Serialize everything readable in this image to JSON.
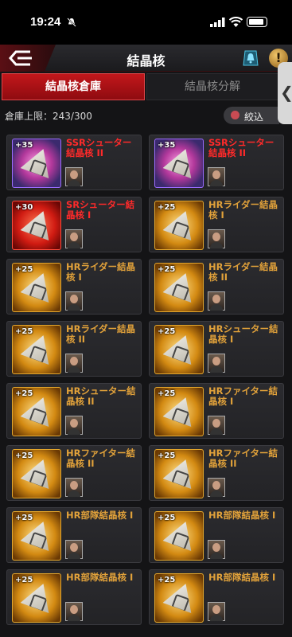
{
  "status_bar": {
    "time": "19:24"
  },
  "header": {
    "title": "結晶核"
  },
  "tabs": [
    {
      "label": "結晶核倉庫",
      "active": true
    },
    {
      "label": "結晶核分解",
      "active": false
    }
  ],
  "capacity": {
    "text": "倉庫上限：243/300"
  },
  "filter": {
    "label": "絞込"
  },
  "colors": {
    "ssr": "#ff2a2a",
    "hr": "#e2a23a",
    "active_tab": "#c3171b"
  },
  "cores": [
    {
      "level": "+35",
      "name": "SSRシューター結晶核 II",
      "rarity": "ssr"
    },
    {
      "level": "+35",
      "name": "SSRシューター結晶核 II",
      "rarity": "ssr"
    },
    {
      "level": "+30",
      "name": "SRシューター結晶核 I",
      "rarity": "sr"
    },
    {
      "level": "+25",
      "name": "HRライダー結晶核 I",
      "rarity": "hr"
    },
    {
      "level": "+25",
      "name": "HRライダー結晶核 I",
      "rarity": "hr"
    },
    {
      "level": "+25",
      "name": "HRライダー結晶核 II",
      "rarity": "hr"
    },
    {
      "level": "+25",
      "name": "HRライダー結晶核 II",
      "rarity": "hr"
    },
    {
      "level": "+25",
      "name": "HRシューター結晶核 I",
      "rarity": "hr"
    },
    {
      "level": "+25",
      "name": "HRシューター結晶核 II",
      "rarity": "hr"
    },
    {
      "level": "+25",
      "name": "HRファイター結晶核 I",
      "rarity": "hr"
    },
    {
      "level": "+25",
      "name": "HRファイター結晶核 II",
      "rarity": "hr"
    },
    {
      "level": "+25",
      "name": "HRファイター結晶核 II",
      "rarity": "hr"
    },
    {
      "level": "+25",
      "name": "HR部隊結晶核 I",
      "rarity": "hr"
    },
    {
      "level": "+25",
      "name": "HR部隊結晶核 I",
      "rarity": "hr"
    },
    {
      "level": "+25",
      "name": "HR部隊結晶核 I",
      "rarity": "hr"
    },
    {
      "level": "+25",
      "name": "HR部隊結晶核 I",
      "rarity": "hr"
    }
  ]
}
